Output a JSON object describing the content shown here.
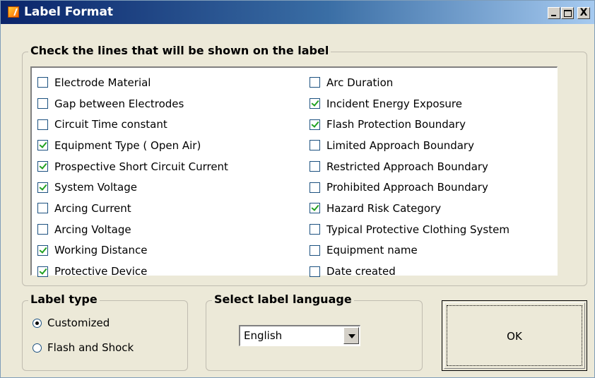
{
  "window": {
    "title": "Label Format",
    "minimize_label": "_",
    "maximize_label": "□",
    "close_label": "X"
  },
  "lines_group": {
    "legend": "Check the lines that will be shown on the label",
    "left_items": [
      {
        "label": "Electrode Material",
        "checked": false
      },
      {
        "label": "Gap between Electrodes",
        "checked": false
      },
      {
        "label": "Circuit Time constant",
        "checked": false
      },
      {
        "label": "Equipment Type ( Open Air)",
        "checked": true
      },
      {
        "label": "Prospective Short Circuit Current",
        "checked": true
      },
      {
        "label": "System Voltage",
        "checked": true
      },
      {
        "label": "Arcing Current",
        "checked": false
      },
      {
        "label": "Arcing Voltage",
        "checked": false
      },
      {
        "label": "Working Distance",
        "checked": true
      },
      {
        "label": "Protective Device",
        "checked": true
      }
    ],
    "right_items": [
      {
        "label": "Arc Duration",
        "checked": false
      },
      {
        "label": "Incident Energy Exposure",
        "checked": true
      },
      {
        "label": "Flash Protection Boundary",
        "checked": true
      },
      {
        "label": "Limited Approach Boundary",
        "checked": false
      },
      {
        "label": "Restricted Approach Boundary",
        "checked": false
      },
      {
        "label": "Prohibited Approach Boundary",
        "checked": false
      },
      {
        "label": "Hazard Risk Category",
        "checked": true
      },
      {
        "label": "Typical Protective Clothing System",
        "checked": false
      },
      {
        "label": "Equipment name",
        "checked": false
      },
      {
        "label": "Date created",
        "checked": false
      }
    ]
  },
  "label_type": {
    "legend": "Label type",
    "options": [
      {
        "label": "Customized",
        "selected": true
      },
      {
        "label": "Flash and Shock",
        "selected": false
      }
    ]
  },
  "language": {
    "legend": "Select label language",
    "selected": "English"
  },
  "ok_button": {
    "label": "OK"
  }
}
